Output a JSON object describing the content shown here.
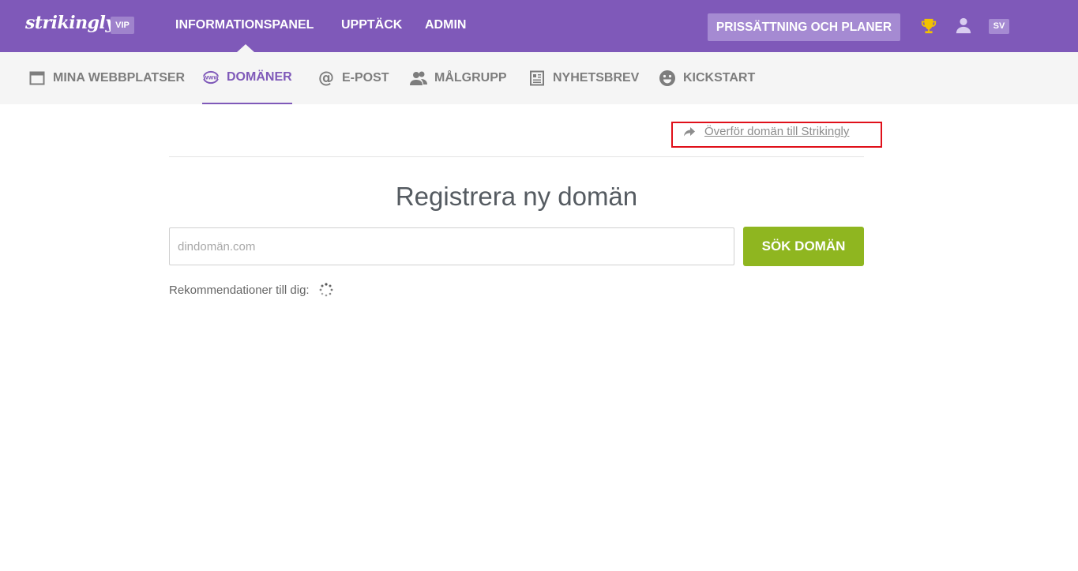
{
  "brand": {
    "logo_text": "strikingly",
    "vip_label": "VIP",
    "accent": "#7f59b9"
  },
  "topnav": {
    "items": [
      {
        "label": "INFORMATIONSPANEL"
      },
      {
        "label": "UPPTÄCK"
      },
      {
        "label": "ADMIN"
      }
    ],
    "pricing_label": "PRISSÄTTNING OCH PLANER",
    "trophy_icon": "trophy-icon",
    "user_icon": "user-icon",
    "language_label": "SV"
  },
  "subnav": {
    "items": [
      {
        "label": "MINA WEBBPLATSER",
        "icon": "browser-window-icon"
      },
      {
        "label": "DOMÄNER",
        "icon": "www-globe-icon",
        "active": true
      },
      {
        "label": "E-POST",
        "icon": "at-icon"
      },
      {
        "label": "MÅLGRUPP",
        "icon": "users-icon"
      },
      {
        "label": "NYHETSBREV",
        "icon": "newsletter-icon"
      },
      {
        "label": "KICKSTART",
        "icon": "smiley-icon"
      }
    ]
  },
  "main": {
    "transfer_link": "Överför domän till Strikingly",
    "heading": "Registrera ny domän",
    "search": {
      "placeholder": "dindomän.com",
      "value": ""
    },
    "search_button": "SÖK DOMÄN",
    "recommendations_label": "Rekommendationer till dig:"
  },
  "colors": {
    "topbar": "#7f59b9",
    "subnav_bg": "#f5f5f5",
    "search_button": "#8fb620",
    "highlight": "#e0101a"
  }
}
